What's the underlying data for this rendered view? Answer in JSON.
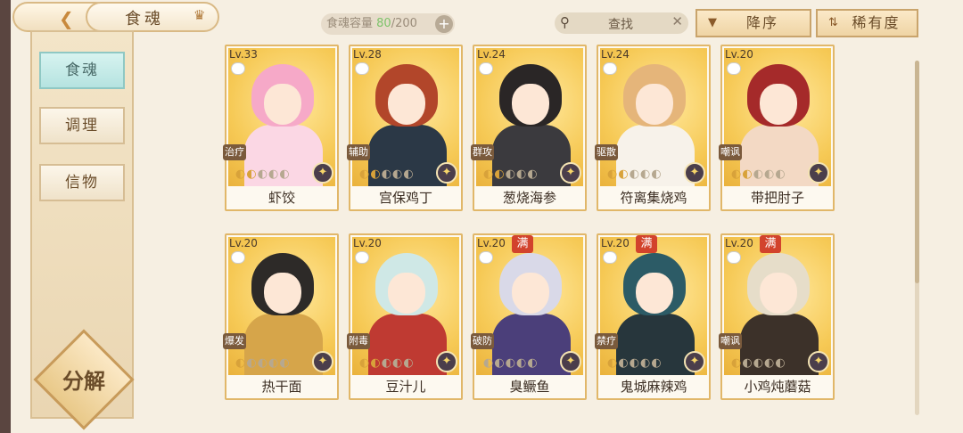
{
  "header": {
    "title": "食魂",
    "capacity_label": "食魂容量",
    "capacity_current": "80",
    "capacity_total": "/200",
    "plus": "+",
    "search_label": "查找",
    "sort_label": "降序",
    "rarity_label": "稀有度"
  },
  "sidebar": {
    "items": [
      {
        "label": "食魂",
        "active": true
      },
      {
        "label": "调理",
        "active": false
      },
      {
        "label": "信物",
        "active": false
      }
    ],
    "decompose_label": "分解"
  },
  "cards": [
    {
      "level": "Lv.33",
      "role": "治疗",
      "name": "虾饺",
      "full": "",
      "stars": 5,
      "lit": 2,
      "hair": "#f6a9c8",
      "body": "#fbd7e4"
    },
    {
      "level": "Lv.28",
      "role": "辅助",
      "name": "宫保鸡丁",
      "full": "",
      "stars": 5,
      "lit": 2,
      "hair": "#b2462a",
      "body": "#2b3846"
    },
    {
      "level": "Lv.24",
      "role": "群攻",
      "name": "葱烧海参",
      "full": "",
      "stars": 5,
      "lit": 2,
      "hair": "#2a2626",
      "body": "#3b3a3e"
    },
    {
      "level": "Lv.24",
      "role": "驱散",
      "name": "符离集烧鸡",
      "full": "",
      "stars": 5,
      "lit": 2,
      "hair": "#e5b57a",
      "body": "#f7f2ea"
    },
    {
      "level": "Lv.20",
      "role": "嘲讽",
      "name": "带把肘子",
      "full": "",
      "stars": 5,
      "lit": 2,
      "hair": "#a52a2a",
      "body": "#f3d9c4"
    },
    {
      "level": "Lv.20",
      "role": "爆发",
      "name": "热干面",
      "full": "",
      "stars": 5,
      "lit": 1,
      "hair": "#2d2a28",
      "body": "#d6a54a"
    },
    {
      "level": "Lv.20",
      "role": "附毒",
      "name": "豆汁儿",
      "full": "",
      "stars": 5,
      "lit": 2,
      "hair": "#cfe8e6",
      "body": "#bf3a32"
    },
    {
      "level": "Lv.20",
      "role": "破防",
      "name": "臭鳜鱼",
      "full": "满",
      "stars": 5,
      "lit": 0,
      "hair": "#d9d9e8",
      "body": "#4b3f7a"
    },
    {
      "level": "Lv.20",
      "role": "禁疗",
      "name": "鬼城麻辣鸡",
      "full": "满",
      "stars": 5,
      "lit": 1,
      "hair": "#2c5b66",
      "body": "#27363c"
    },
    {
      "level": "Lv.20",
      "role": "嘲讽",
      "name": "小鸡炖蘑菇",
      "full": "满",
      "stars": 5,
      "lit": 1,
      "hair": "#e6ddc9",
      "body": "#3c3129"
    }
  ],
  "icons": {
    "back": "chevron-left-icon",
    "crown": "crown-icon",
    "search": "search-icon",
    "clear": "close-icon",
    "sort": "triangle-down-icon",
    "rarity": "rarity-icon",
    "element": "sun-element-icon"
  }
}
